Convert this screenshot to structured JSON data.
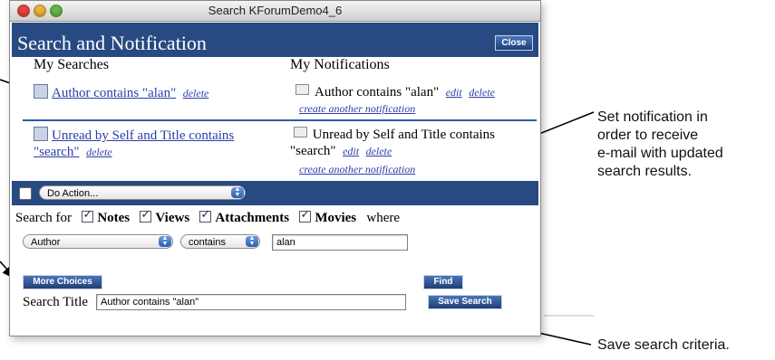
{
  "window": {
    "title": "Search KForumDemo4_6"
  },
  "header": {
    "title": "Search and Notification",
    "close_label": "Close"
  },
  "columns": {
    "searches": "My Searches",
    "notifications": "My Notifications"
  },
  "searches": [
    {
      "title": "Author contains \"alan\"",
      "delete_label": "delete"
    },
    {
      "title_line1": "Unread by Self and Title contains",
      "title_line2": "\"search\"",
      "delete_label": "delete"
    }
  ],
  "notifications": [
    {
      "title": "Author contains \"alan\"",
      "edit_label": "edit",
      "delete_label": "delete",
      "create_label": "create another notification"
    },
    {
      "title_line1": "Unread by Self and Title contains",
      "title_line2": "\"search\"",
      "edit_label": "edit",
      "delete_label": "delete",
      "create_label": "create another notification"
    }
  ],
  "action": {
    "select_value": "Do Action..."
  },
  "search_for": {
    "prefix": "Search for",
    "options": [
      {
        "label": "Notes",
        "checked": true
      },
      {
        "label": "Views",
        "checked": true
      },
      {
        "label": "Attachments",
        "checked": true
      },
      {
        "label": "Movies",
        "checked": true
      }
    ],
    "suffix": "where"
  },
  "criteria": {
    "field": "Author",
    "operator": "contains",
    "value": "alan"
  },
  "buttons": {
    "more_choices": "More Choices",
    "find": "Find",
    "save_search": "Save Search"
  },
  "search_title": {
    "label": "Search Title",
    "value": "Author contains \"alan\""
  },
  "annotations": {
    "notification_line1": "Set notification in",
    "notification_line2": "order to receive",
    "notification_line3": "e-mail with updated",
    "notification_line4": "search results.",
    "save": "Save search criteria."
  },
  "colors": {
    "header_blue": "#274a82",
    "link_blue": "#2b3da8",
    "divider_blue": "#2f5aa5"
  }
}
